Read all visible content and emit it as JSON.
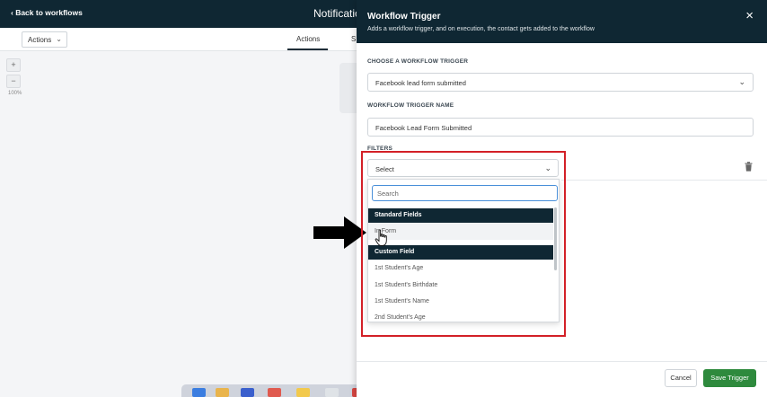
{
  "background_app": {
    "back_link": "‹ Back to workflows",
    "page_title": "Notificatio",
    "actions_dropdown": "Actions",
    "tab_actions": "Actions",
    "tab_settings_partial": "S",
    "zoom_in": "+",
    "zoom_out": "−",
    "zoom_level": "100%"
  },
  "panel": {
    "title": "Workflow Trigger",
    "subtitle": "Adds a workflow trigger, and on execution, the contact gets added to the workflow",
    "close": "×",
    "trigger_label": "CHOOSE A WORKFLOW TRIGGER",
    "trigger_value": "Facebook lead form submitted",
    "name_label": "WORKFLOW TRIGGER NAME",
    "name_value": "Facebook Lead Form Submitted",
    "filters_label": "FILTERS",
    "filter_select": "Select",
    "search_placeholder": "Search",
    "groups": [
      {
        "label": "Standard Fields",
        "options": [
          "In Form"
        ]
      },
      {
        "label": "Custom Field",
        "options": [
          "1st Student's Age",
          "1st Student's Birthdate",
          "1st Student's Name",
          "2nd Student's Age"
        ]
      }
    ],
    "cancel": "Cancel",
    "save": "Save Trigger"
  },
  "colors": {
    "header": "#0f2733",
    "save_button": "#2e8a3d",
    "highlight": "#d32027"
  },
  "icons": [
    "chevron-down-icon",
    "close-icon",
    "trash-icon",
    "hand-cursor-icon",
    "arrow-annotation-icon"
  ]
}
